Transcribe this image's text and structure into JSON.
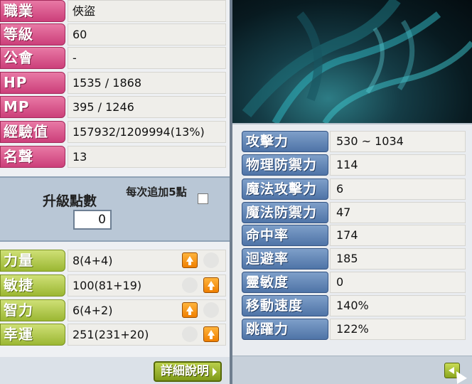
{
  "character": {
    "rows": [
      {
        "label": "職業",
        "value": "俠盜"
      },
      {
        "label": "等級",
        "value": "60"
      },
      {
        "label": "公會",
        "value": "-"
      },
      {
        "label": "HP",
        "value": "1535 / 1868"
      },
      {
        "label": "MP",
        "value": "395 / 1246"
      },
      {
        "label": "經驗值",
        "value": "157932/1209994(13%)"
      },
      {
        "label": "名聲",
        "value": "13"
      }
    ]
  },
  "ability_points": {
    "title": "升級點數",
    "value": "0",
    "add5_label": "每次追加5點",
    "add5_checked": false
  },
  "stats": [
    {
      "label": "力量",
      "value": "8(4+4)",
      "up_button_first": true
    },
    {
      "label": "敏捷",
      "value": "100(81+19)",
      "up_button_first": false
    },
    {
      "label": "智力",
      "value": "6(4+2)",
      "up_button_first": true
    },
    {
      "label": "幸運",
      "value": "251(231+20)",
      "up_button_first": false
    }
  ],
  "detail_button_label": "詳細說明",
  "details": [
    {
      "label": "攻擊力",
      "value": "530 ~ 1034"
    },
    {
      "label": "物理防禦力",
      "value": "114"
    },
    {
      "label": "魔法攻擊力",
      "value": "6"
    },
    {
      "label": "魔法防禦力",
      "value": "47"
    },
    {
      "label": "命中率",
      "value": "174"
    },
    {
      "label": "迴避率",
      "value": "185"
    },
    {
      "label": "靈敏度",
      "value": "0"
    },
    {
      "label": "移動速度",
      "value": "140%"
    },
    {
      "label": "跳躍力",
      "value": "122%"
    }
  ],
  "colors": {
    "pink_label": "#cc3f7a",
    "green_label": "#9bb733",
    "blue_label": "#4f74a7",
    "up_button": "#ef7f00"
  }
}
